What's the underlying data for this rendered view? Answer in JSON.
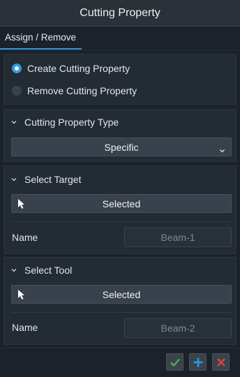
{
  "window": {
    "title": "Cutting Property"
  },
  "tabs": [
    {
      "label": "Assign / Remove",
      "active": true
    }
  ],
  "mode": {
    "options": [
      {
        "label": "Create Cutting Property",
        "selected": true
      },
      {
        "label": "Remove Cutting Property",
        "selected": false
      }
    ]
  },
  "cutting_type": {
    "header": "Cutting Property Type",
    "value": "Specific"
  },
  "target": {
    "header": "Select Target",
    "selector_label": "Selected",
    "name_label": "Name",
    "name_placeholder": "Beam-1"
  },
  "tool": {
    "header": "Select Tool",
    "selector_label": "Selected",
    "name_label": "Name",
    "name_placeholder": "Beam-2"
  },
  "colors": {
    "accent": "#2e9ad8",
    "ok": "#4caf50",
    "add": "#2a9be0",
    "cancel": "#e0453a"
  },
  "footer_icons": [
    "check-icon",
    "plus-icon",
    "close-icon"
  ]
}
